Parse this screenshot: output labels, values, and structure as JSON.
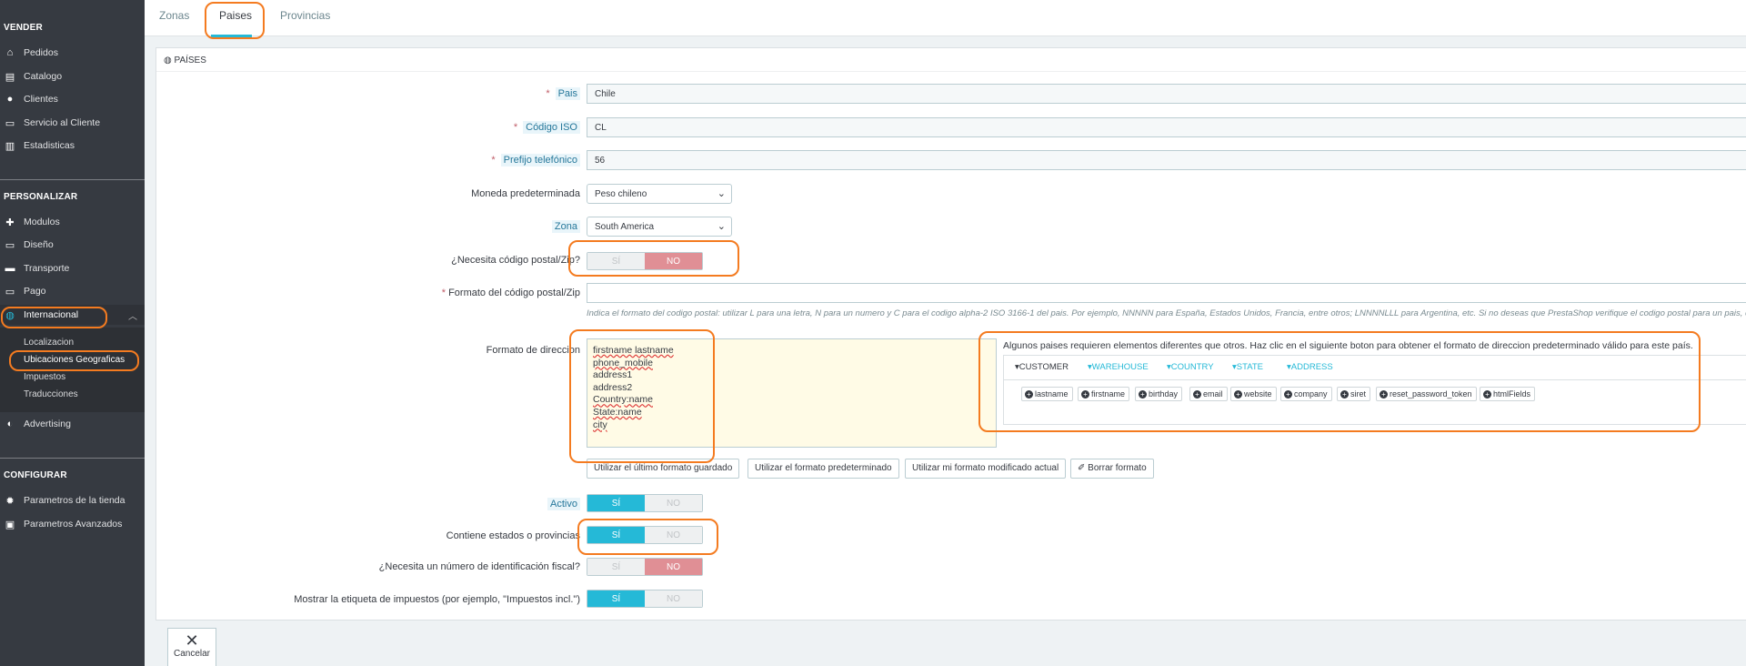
{
  "sidebar": {
    "sections": {
      "vender": "VENDER",
      "personalizar": "PERSONALIZAR",
      "configurar": "CONFIGURAR"
    },
    "items": {
      "pedidos": "Pedidos",
      "catalogo": "Catalogo",
      "clientes": "Clientes",
      "servicio": "Servicio al Cliente",
      "estadisticas": "Estadisticas",
      "modulos": "Modulos",
      "diseno": "Diseño",
      "transporte": "Transporte",
      "pago": "Pago",
      "internacional": "Internacional",
      "advertising": "Advertising",
      "parametros_tienda": "Parametros de la tienda",
      "parametros_avanzados": "Parametros Avanzados"
    },
    "submenu": {
      "localizacion": "Localizacion",
      "ubicaciones": "Ubicaciones Geograficas",
      "impuestos": "Impuestos",
      "traducciones": "Traducciones"
    }
  },
  "tabs": {
    "zonas": "Zonas",
    "paises": "Paises",
    "provincias": "Provincias"
  },
  "panel": {
    "title": "PAÍSES"
  },
  "form": {
    "pais_label": "Pais",
    "pais_value": "Chile",
    "iso_label": "Código ISO",
    "iso_value": "CL",
    "prefijo_label": "Prefijo telefónico",
    "prefijo_value": "56",
    "moneda_label": "Moneda predeterminada",
    "moneda_value": "Peso chileno",
    "zona_label": "Zona",
    "zona_value": "South America",
    "postal_label": "¿Necesita código postal/Zip?",
    "formato_postal_label": "Formato del código postal/Zip",
    "formato_postal_value": "",
    "formato_postal_help": "Indica el formato del codigo postal: utilizar L para una letra, N para un numero y C para el codigo alpha-2 ISO 3166-1 del pais. Por ejemplo, NNNNN para España, Estados Unidos, Francia, entre otros; LNNNNLLL para Argentina, etc. Si no deseas que PrestaShop verifique el codigo postal para un pais, d",
    "direccion_label": "Formato de direccion",
    "address_lines": [
      "firstname lastname",
      "phone_mobile",
      "address1",
      "address2",
      "Country:name",
      "State:name",
      "city"
    ],
    "address_buttons": {
      "last": "Utilizar el último formato guardado",
      "default": "Utilizar el formato predeterminado",
      "current": "Utilizar mi formato modificado actual",
      "clear": "Borrar formato"
    },
    "format_help": "Algunos paises requieren elementos diferentes que otros. Haz clic en el siguiente boton para obtener el formato de direccion predeterminado válido para este país.",
    "format_tabs": {
      "customer": "CUSTOMER",
      "warehouse": "WAREHOUSE",
      "country": "COUNTRY",
      "state": "STATE",
      "address": "ADDRESS"
    },
    "chips": {
      "c0": "lastname",
      "c1": "firstname",
      "c2": "birthday",
      "c3": "email",
      "c4": "website",
      "c5": "company",
      "c6": "siret",
      "c7": "reset_password_token",
      "c8": "htmlFields"
    },
    "activo_label": "Activo",
    "estados_label": "Contiene estados o provincias",
    "fiscal_label": "¿Necesita un número de identificación fiscal?",
    "impuestos_label": "Mostrar la etiqueta de impuestos (por ejemplo, \"Impuestos incl.\")",
    "switch_si": "SÍ",
    "switch_no": "NO"
  },
  "footer": {
    "cancel": "Cancelar"
  },
  "colors": {
    "accent": "#25b9d7",
    "danger": "#e08f95",
    "highlight": "#f47b20",
    "sidebar": "#363a41"
  }
}
